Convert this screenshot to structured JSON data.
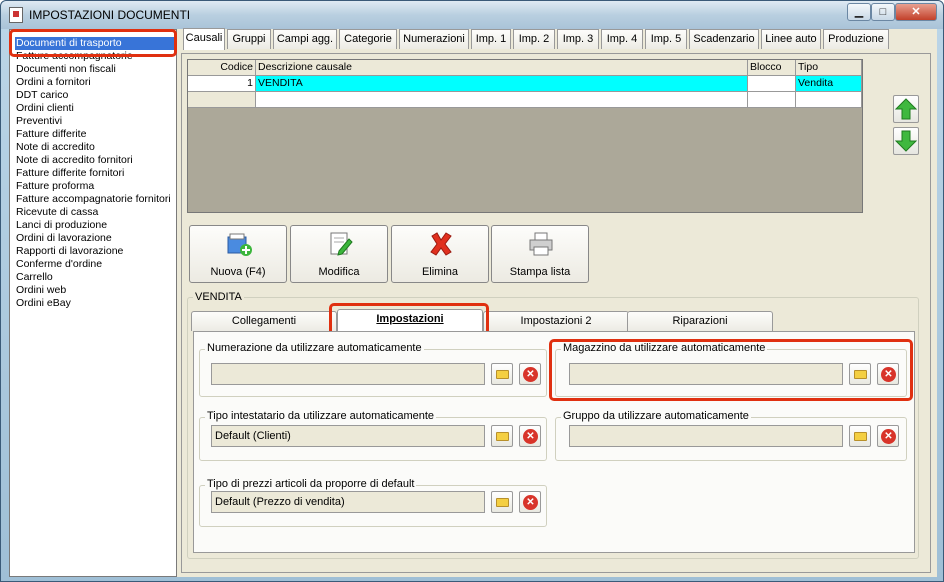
{
  "window": {
    "title": "IMPOSTAZIONI DOCUMENTI",
    "min": "▁",
    "max": "□",
    "close": "✕"
  },
  "sidebar": {
    "items": [
      "Documenti di trasporto",
      "Fatture accompagnatorie",
      "Documenti non fiscali",
      "Ordini a fornitori",
      "DDT carico",
      "Ordini clienti",
      "Preventivi",
      "Fatture differite",
      "Note di accredito",
      "Note di accredito fornitori",
      "Fatture differite fornitori",
      "Fatture proforma",
      "Fatture accompagnatorie fornitori",
      "Ricevute di cassa",
      "Lanci di produzione",
      "Ordini di lavorazione",
      "Rapporti di lavorazione",
      "Conferme d'ordine",
      "Carrello",
      "Ordini web",
      "Ordini eBay"
    ]
  },
  "top_tabs": [
    "Causali",
    "Gruppi",
    "Campi agg.",
    "Categorie",
    "Numerazioni",
    "Imp. 1",
    "Imp. 2",
    "Imp. 3",
    "Imp. 4",
    "Imp. 5",
    "Scadenzario",
    "Linee auto",
    "Produzione"
  ],
  "grid": {
    "headers": [
      "Codice",
      "Descrizione causale",
      "Blocco",
      "Tipo"
    ],
    "rows": [
      [
        "1",
        "VENDITA",
        "",
        "Vendita"
      ],
      [
        "",
        "",
        "",
        ""
      ]
    ]
  },
  "actions": {
    "nuova": "Nuova (F4)",
    "modifica": "Modifica",
    "elimina": "Elimina",
    "stampa": "Stampa lista"
  },
  "section": {
    "title": "VENDITA"
  },
  "inner_tabs": [
    "Collegamenti",
    "Impostazioni",
    "Impostazioni 2",
    "Riparazioni"
  ],
  "fields": {
    "numerazione": {
      "label": "Numerazione da utilizzare automaticamente",
      "value": ""
    },
    "magazzino": {
      "label": "Magazzino da utilizzare automaticamente",
      "value": ""
    },
    "intestatario": {
      "label": "Tipo intestatario da utilizzare automaticamente",
      "value": "Default (Clienti)"
    },
    "gruppo": {
      "label": "Gruppo da utilizzare automaticamente",
      "value": ""
    },
    "prezzi": {
      "label": "Tipo di prezzi articoli da proporre di default",
      "value": "Default (Prezzo di vendita)"
    }
  },
  "colors": {
    "selected_row": "#00ffff",
    "callout": "#e03010",
    "selection": "#3874d8"
  }
}
